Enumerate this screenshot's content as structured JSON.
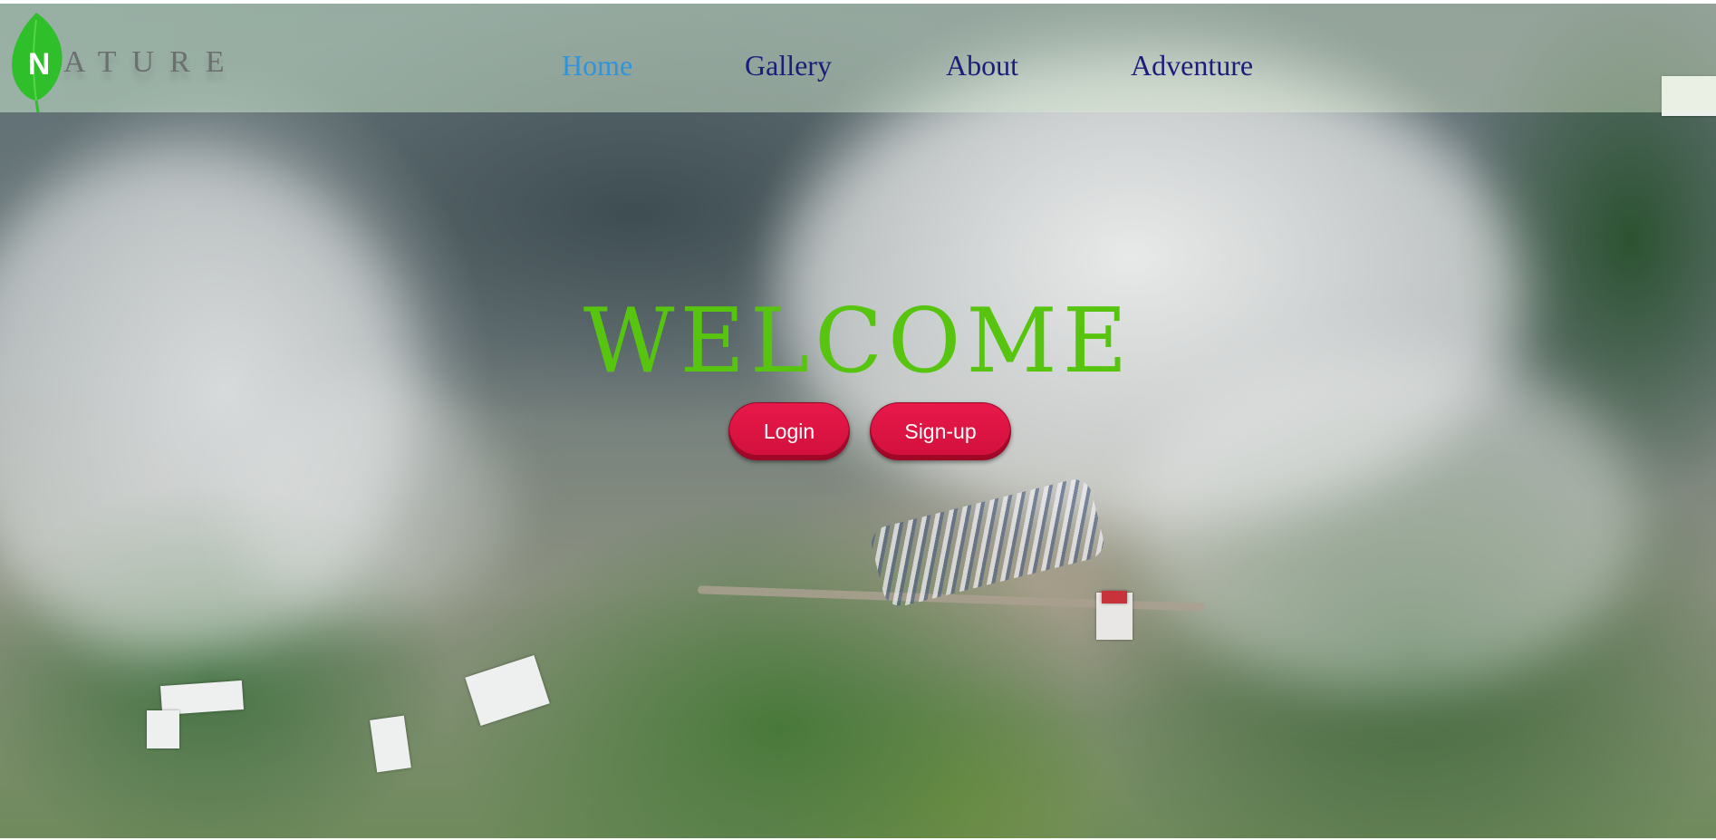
{
  "logo": {
    "initial": "N",
    "rest": "ATURE",
    "icon": "leaf-icon",
    "color": "#2fbf2a"
  },
  "nav": {
    "items": [
      {
        "label": "Home",
        "active": true
      },
      {
        "label": "Gallery",
        "active": false
      },
      {
        "label": "About",
        "active": false
      },
      {
        "label": "Adventure",
        "active": false
      }
    ],
    "link_color": "#1b1d7a",
    "active_color": "#2f93dd"
  },
  "hero": {
    "title": "WELCOME",
    "title_color": "#57c50f",
    "background": "aerial-coastal-fog-image",
    "login_label": "Login",
    "signup_label": "Sign-up",
    "button_color": "#d81442"
  }
}
